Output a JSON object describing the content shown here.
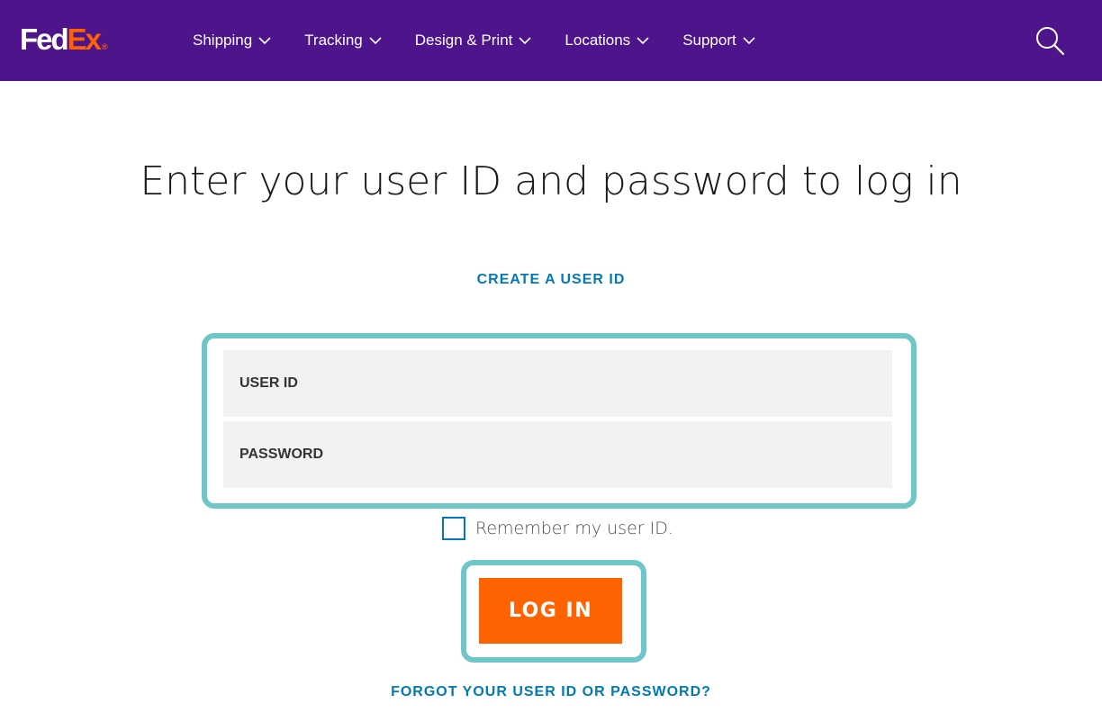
{
  "header": {
    "logo": {
      "part1": "Fed",
      "part2": "Ex",
      "registered": "®"
    },
    "nav": [
      {
        "label": "Shipping"
      },
      {
        "label": "Tracking"
      },
      {
        "label": "Design & Print"
      },
      {
        "label": "Locations"
      },
      {
        "label": "Support"
      }
    ],
    "search_icon": "search-icon",
    "colors": {
      "bar": "#4d148c",
      "logo_accent": "#ff6200"
    }
  },
  "main": {
    "heading": "Enter your user ID and password to log in",
    "create_link": "CREATE A USER ID",
    "form": {
      "user_id_placeholder": "USER ID",
      "password_placeholder": "PASSWORD",
      "remember_label": "Remember my user ID.",
      "remember_checked": false
    },
    "login_button": "LOG IN",
    "forgot_link": "FORGOT YOUR USER ID OR PASSWORD?",
    "colors": {
      "link": "#007ab7",
      "button": "#ff6200",
      "highlight": "#6ec6c6"
    }
  }
}
